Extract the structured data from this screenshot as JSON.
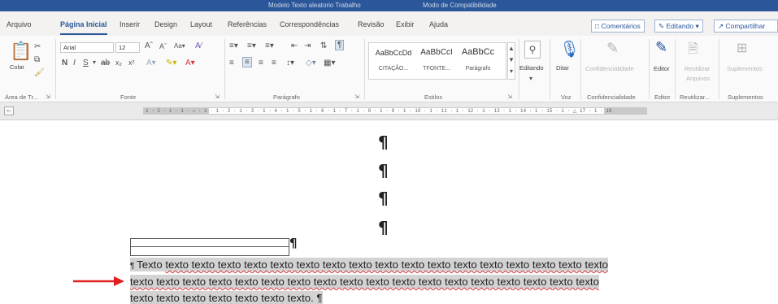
{
  "titlebar": {
    "filename_fragment": "Modelo Texto aleatorio Trabalho",
    "mode": "Modo de Compatibilidade"
  },
  "tabs": [
    {
      "label": "Arquivo"
    },
    {
      "label": "Página Inicial"
    },
    {
      "label": "Inserir"
    },
    {
      "label": "Design"
    },
    {
      "label": "Layout"
    },
    {
      "label": "Referências"
    },
    {
      "label": "Correspondências"
    },
    {
      "label": "Revisão"
    },
    {
      "label": "Exibir"
    },
    {
      "label": "Ajuda"
    }
  ],
  "top_buttons": {
    "comments": "Comentários",
    "editing": "Editando",
    "share": "Compartilhar"
  },
  "ribbon": {
    "clipboard": {
      "paste_label": "Colar",
      "group_label": "Área de Tr..."
    },
    "font": {
      "font_name": "Arial",
      "font_size": "12",
      "group_label": "Fonte"
    },
    "paragraph": {
      "group_label": "Parágrafo"
    },
    "styles": {
      "group_label": "Estilos",
      "items": [
        {
          "preview": "AaBbCcDd",
          "name": "CITAÇÃO..."
        },
        {
          "preview": "AaBbCcI",
          "name": "TFONTE..."
        },
        {
          "preview": "AaBbCc",
          "name": "Parágrafo"
        }
      ]
    },
    "editing": {
      "label": "Editando"
    },
    "voice": {
      "button_label": "Ditar",
      "group_label": "Voz"
    },
    "sensitivity": {
      "button_label": "Confidencialidade",
      "group_label": "Confidencialidade"
    },
    "editor": {
      "button_label": "Editor",
      "group_label": "Editor"
    },
    "reuse": {
      "button_label_1": "Reutilizar",
      "button_label_2": "Arquivos",
      "group_label": "Reutilizar..."
    },
    "addins": {
      "button_label": "Suplementos",
      "group_label": "Suplementos"
    }
  },
  "ruler": {
    "text": "1 · 2 · 1 · 1 · ⌂ · 1 · 1 · 2 · 1 · 3 · 1 · 4 · 1 · 5 · 1 · 6 · 1 · 7 · 1 · 8 · 1 · 9 · 1 · 10 · 1 · 11 · 1 · 12 · 1 · 13 · 1 · 14 · 1 · 15 · 1 · △ 17 · 1 · 18"
  },
  "document": {
    "pilcrow": "¶",
    "line1_lead": "Texto",
    "line1_body": "texto texto texto texto texto texto texto texto texto texto texto texto texto texto texto texto texto",
    "line2_body": "texto texto texto texto texto texto texto texto texto texto texto texto texto texto texto texto texto texto",
    "line3_body": "texto texto texto texto texto texto texto",
    "line3_end": ".",
    "end_mark": "¶"
  },
  "colors": {
    "accent": "#2b579a",
    "highlight_grey": "#d3d3d3",
    "spell_red": "#d13438",
    "arrow_red": "#e02020"
  }
}
